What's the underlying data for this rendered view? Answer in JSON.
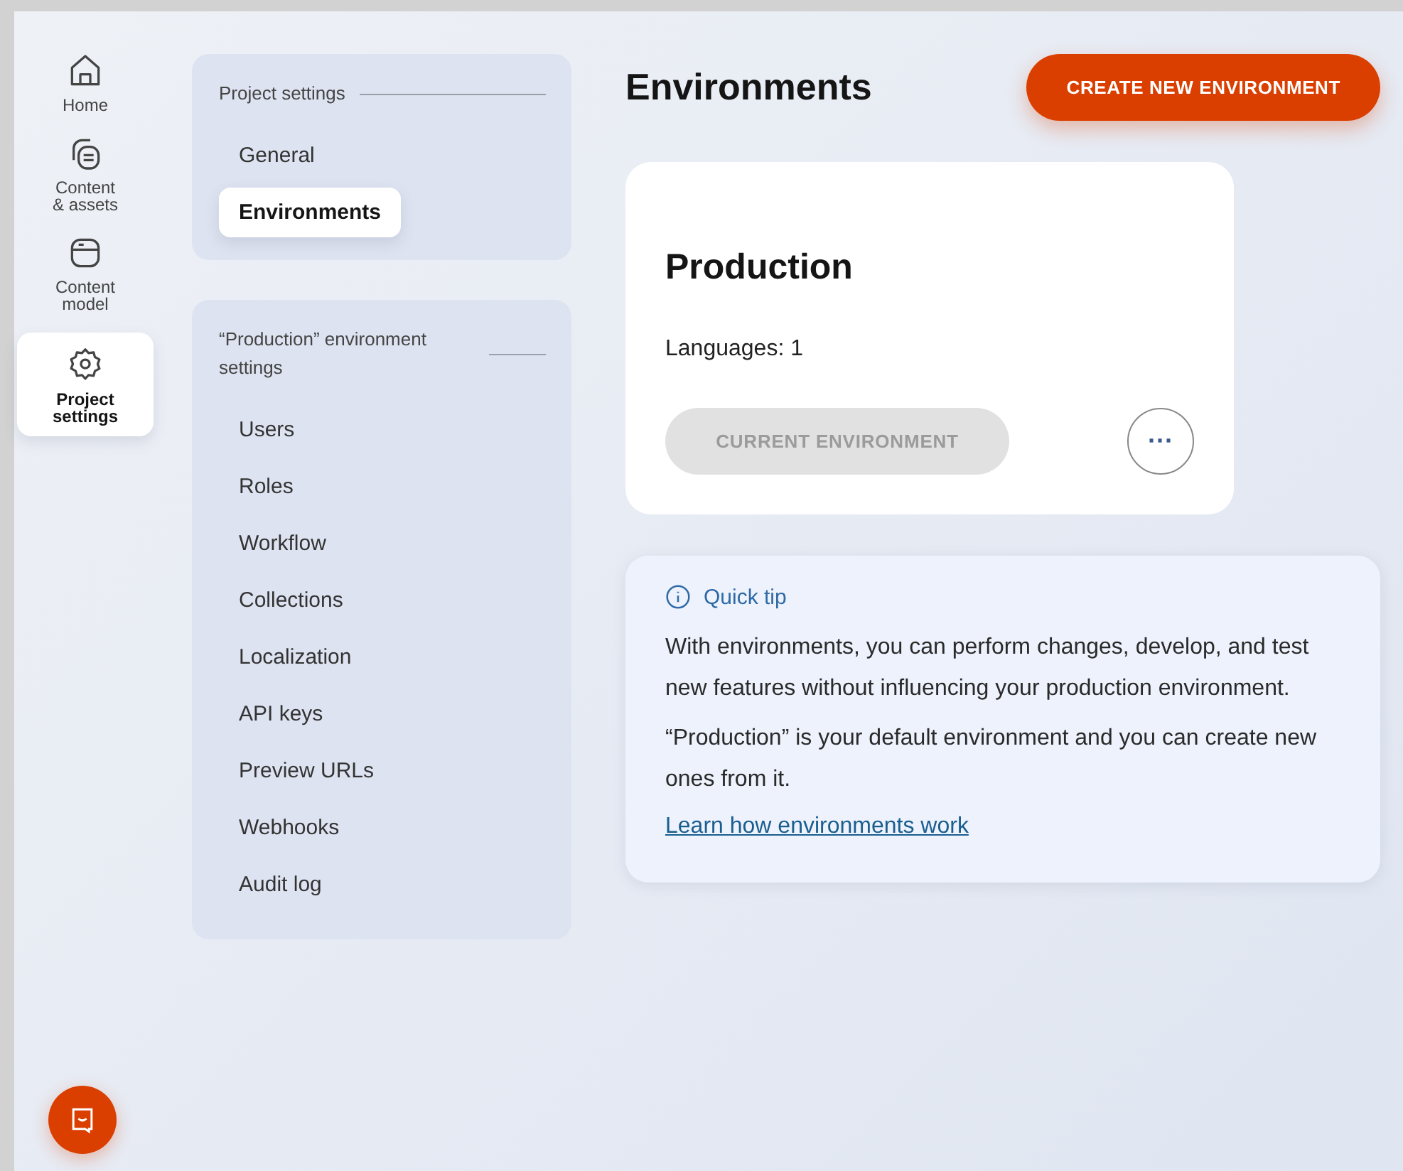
{
  "nav": [
    {
      "kind": "home",
      "label": "Home",
      "selected": false
    },
    {
      "kind": "content",
      "label": "Content\n& assets",
      "selected": false
    },
    {
      "kind": "model",
      "label": "Content\nmodel",
      "selected": false
    },
    {
      "kind": "settings",
      "label": "Project\nsettings",
      "selected": true
    }
  ],
  "settings_groups": [
    {
      "heading": "Project settings",
      "items": [
        {
          "label": "General",
          "selected": false
        },
        {
          "label": "Environments",
          "selected": true
        }
      ]
    },
    {
      "heading": "“Production” environment settings",
      "items": [
        {
          "label": "Users",
          "selected": false
        },
        {
          "label": "Roles",
          "selected": false
        },
        {
          "label": "Workflow",
          "selected": false
        },
        {
          "label": "Collections",
          "selected": false
        },
        {
          "label": "Localization",
          "selected": false
        },
        {
          "label": "API keys",
          "selected": false
        },
        {
          "label": "Preview URLs",
          "selected": false
        },
        {
          "label": "Webhooks",
          "selected": false
        },
        {
          "label": "Audit log",
          "selected": false
        }
      ]
    }
  ],
  "page_title": "Environments",
  "create_button": "CREATE NEW ENVIRONMENT",
  "environments": [
    {
      "name": "Production",
      "languages": "Languages: 1",
      "status_button": "CURRENT ENVIRONMENT",
      "disabled": true,
      "more_button": "···"
    }
  ],
  "tip": {
    "title": "Quick tip",
    "paragraphs": [
      "With environments, you can perform changes, develop, and test new features without influencing your production environment.",
      "“Production” is your default environment and you can create new ones from it."
    ],
    "link": "Learn how environments work"
  }
}
